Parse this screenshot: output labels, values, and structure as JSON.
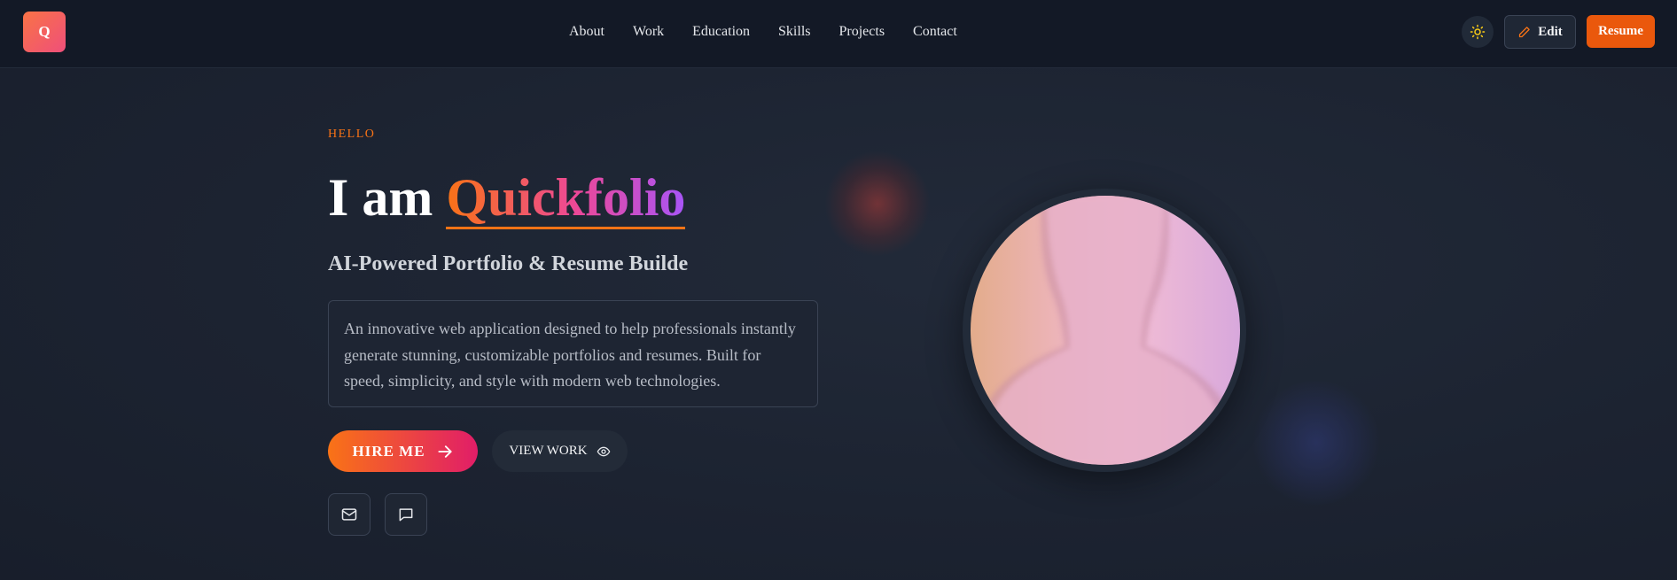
{
  "header": {
    "logo_letter": "Q",
    "nav": [
      "About",
      "Work",
      "Education",
      "Skills",
      "Projects",
      "Contact"
    ],
    "edit_label": "Edit",
    "resume_label": "Resume"
  },
  "hero": {
    "greeting": "HELLO",
    "title_prefix": "I am",
    "title_brand": "Quickfolio",
    "subtitle": "AI-Powered Portfolio & Resume Builde",
    "description": "An innovative web application designed to help professionals instantly generate stunning, customizable portfolios and resumes. Built for speed, simplicity, and style with modern web technologies.",
    "hire_label": "HIRE ME",
    "view_label": "VIEW WORK"
  },
  "icons": {
    "theme": "sun-icon",
    "edit": "pencil-icon",
    "hire": "arrow-right-icon",
    "view": "eye-icon",
    "mail": "mail-icon",
    "chat": "chat-icon"
  },
  "colors": {
    "accent": "#ea580c",
    "brand_gradient_start": "#f97316",
    "brand_gradient_mid": "#ec4899",
    "brand_gradient_end": "#a855f7",
    "background": "#1b2230"
  }
}
